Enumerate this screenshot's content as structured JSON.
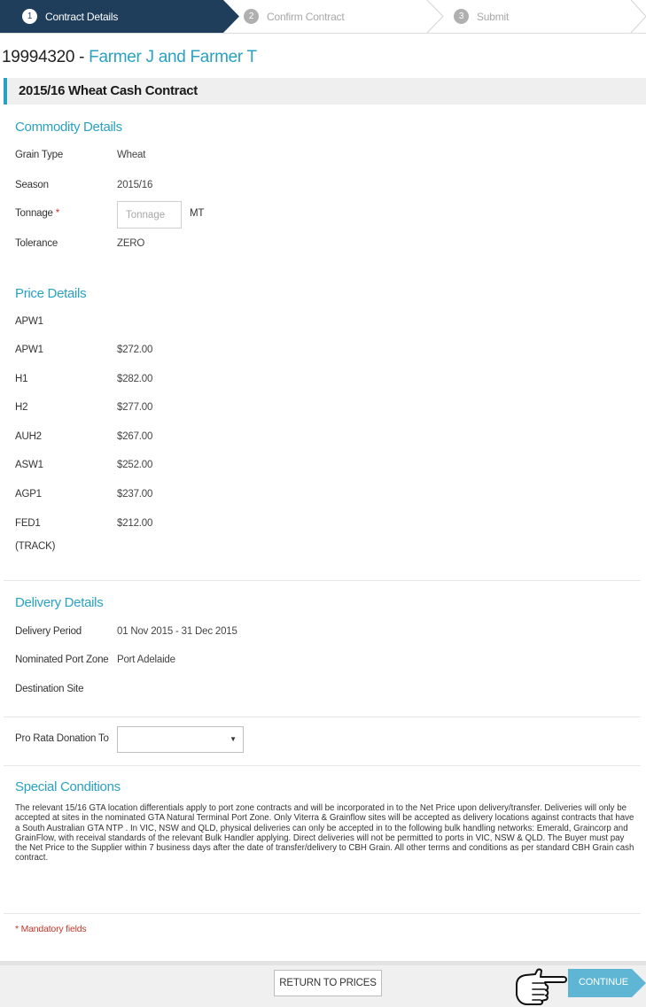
{
  "stepper": {
    "steps": [
      {
        "num": "1",
        "label": "Contract Details"
      },
      {
        "num": "2",
        "label": "Confirm Contract"
      },
      {
        "num": "3",
        "label": "Submit"
      }
    ]
  },
  "contract": {
    "number": "19994320",
    "separator": " - ",
    "name": "Farmer J and Farmer T",
    "title": "2015/16 Wheat Cash Contract"
  },
  "commodity": {
    "title": "Commodity Details",
    "grain_type_label": "Grain Type",
    "grain_type_value": "Wheat",
    "season_label": "Season",
    "season_value": "2015/16",
    "tonnage_label": "Tonnage",
    "tonnage_required": "*",
    "tonnage_placeholder": "Tonnage",
    "tonnage_unit": "MT",
    "tolerance_label": "Tolerance",
    "tolerance_value": "ZERO"
  },
  "price": {
    "title": "Price Details",
    "group_label": "APW1",
    "rows": [
      {
        "grade": "APW1",
        "price": "$272.00"
      },
      {
        "grade": "H1",
        "price": "$282.00"
      },
      {
        "grade": "H2",
        "price": "$277.00"
      },
      {
        "grade": "AUH2",
        "price": "$267.00"
      },
      {
        "grade": "ASW1",
        "price": "$252.00"
      },
      {
        "grade": "AGP1",
        "price": "$237.00"
      },
      {
        "grade": "FED1",
        "price": "$212.00"
      }
    ],
    "track_note": "(TRACK)"
  },
  "delivery": {
    "title": "Delivery Details",
    "period_label": "Delivery Period",
    "period_value": "01 Nov 2015 - 31 Dec 2015",
    "port_zone_label": "Nominated Port Zone",
    "port_zone_value": "Port Adelaide",
    "destination_label": "Destination Site"
  },
  "donation": {
    "label": "Pro Rata Donation To",
    "selected": ""
  },
  "special": {
    "title": "Special Conditions",
    "text": "The relevant 15/16 GTA location differentials apply to port zone contracts and will be incorporated in to the Net Price upon delivery/transfer. Deliveries will only be accepted at sites in the nominated GTA Natural Terminal Port Zone. Only Viterra & Grainflow sites will be accepted as delivery locations against contracts that have a South Australian GTA NTP . In VIC, NSW and QLD, physical deliveries can only be accepted in to the following bulk handling networks: Emerald, Graincorp and GrainFlow, with receival standards of the relevant Bulk Handler applying. Direct deliveries will not be permitted to ports in VIC, NSW & QLD. The Buyer must pay the Net Price to the Supplier within 7 business days after the date of transfer/delivery to CBH Grain. All other terms and conditions as per standard CBH Grain cash contract."
  },
  "mandatory_note": "* Mandatory fields",
  "footer": {
    "return_label": "RETURN TO PRICES",
    "continue_label": "CONTINUE"
  },
  "colors": {
    "accent": "#2aa1c1",
    "active_step": "#1f3e5c",
    "required": "#c0392b"
  },
  "icons": {
    "cursor": "pointing-hand-icon",
    "select_caret": "caret-down-icon"
  }
}
